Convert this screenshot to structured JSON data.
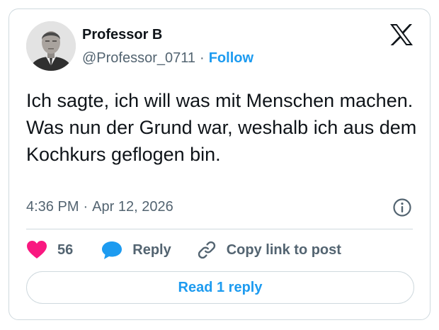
{
  "author": {
    "name": "Professor B",
    "handle": "@Professor_0711",
    "follow_label": "Follow"
  },
  "tweet": {
    "text": "Ich sagte, ich will was mit Menschen machen. Was nun der Grund war, weshalb ich aus dem Kochkurs geflogen bin.",
    "time": "4:36 PM",
    "date": "Apr 12, 2026"
  },
  "actions": {
    "like_count": "56",
    "reply_label": "Reply",
    "copy_label": "Copy link to post"
  },
  "read_replies_label": "Read 1 reply",
  "icons": {
    "platform": "x-logo-icon",
    "info": "info-icon",
    "like": "heart-icon",
    "reply": "speech-bubble-icon",
    "copy": "link-icon"
  },
  "colors": {
    "accent": "#1d9bf0",
    "like": "#f91880",
    "text": "#0f1419",
    "muted": "#536471",
    "border": "#cfd9de"
  }
}
